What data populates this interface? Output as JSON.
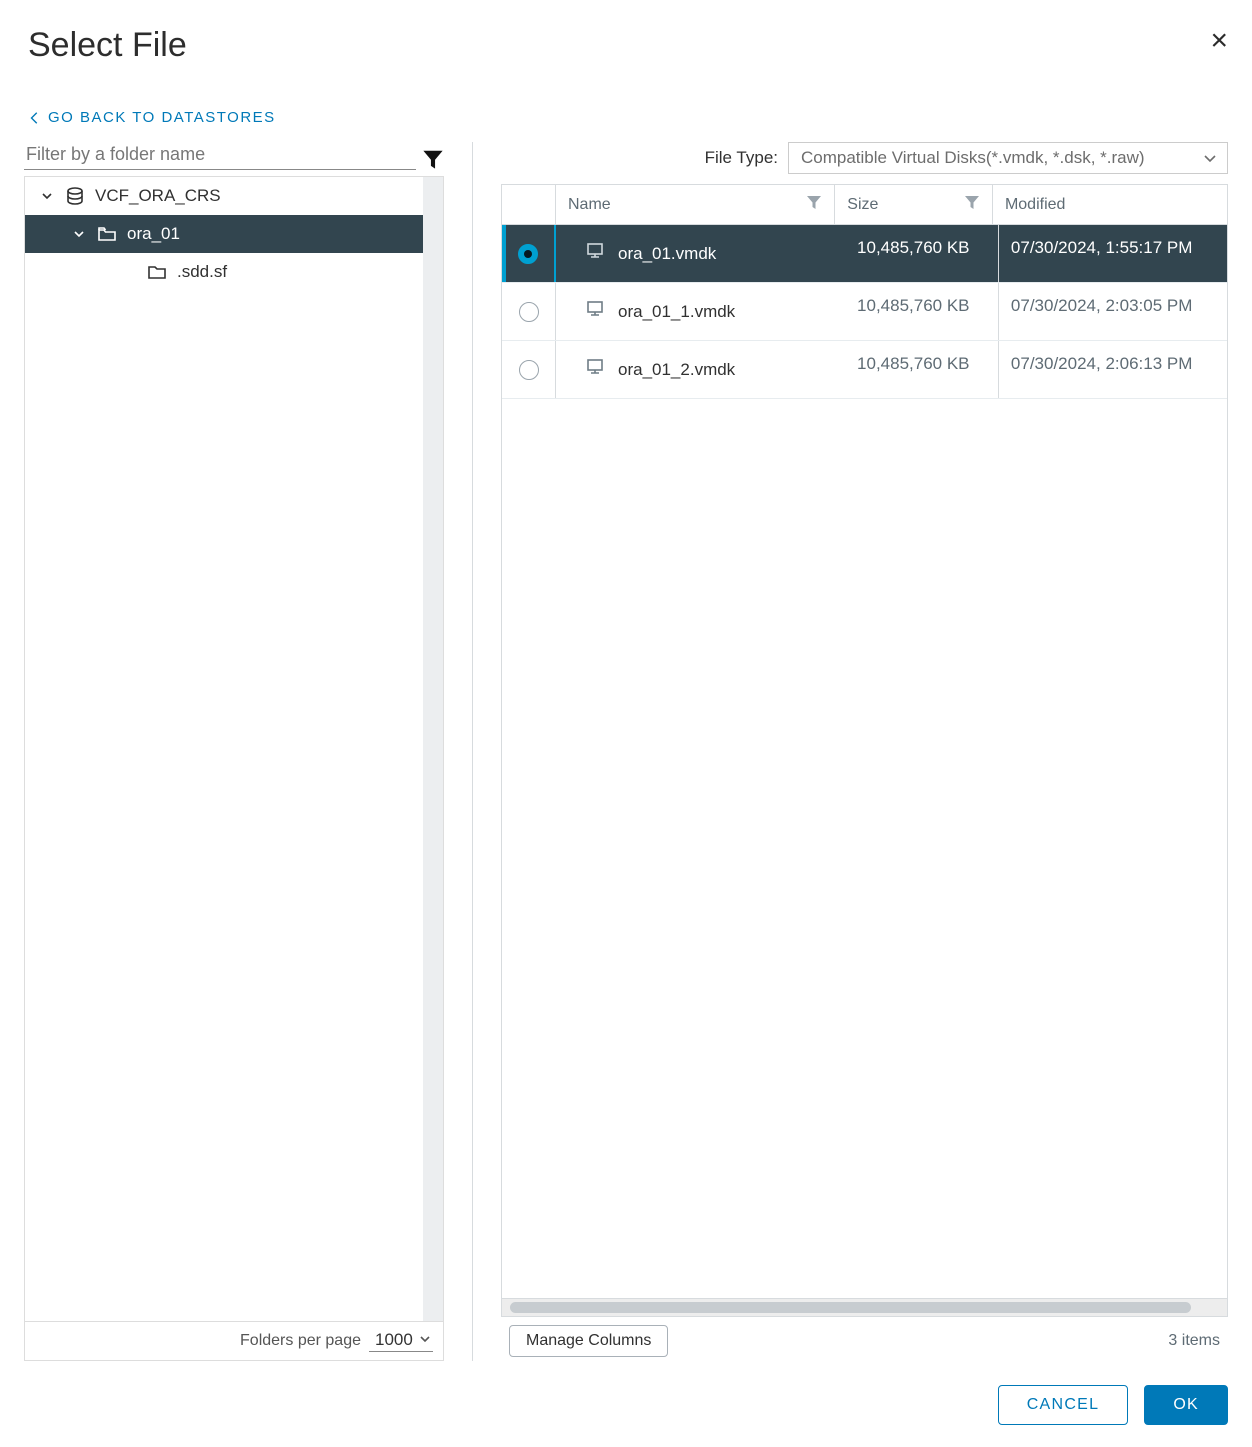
{
  "dialog": {
    "title": "Select File",
    "back_link": "GO BACK TO DATASTORES",
    "cancel_label": "CANCEL",
    "ok_label": "OK"
  },
  "left": {
    "filter_placeholder": "Filter by a folder name",
    "folders_per_page_label": "Folders per page",
    "folders_per_page_value": "1000",
    "tree": {
      "root": {
        "label": "VCF_ORA_CRS"
      },
      "folder_open": {
        "label": "ora_01"
      },
      "folder_child": {
        "label": ".sdd.sf"
      }
    }
  },
  "right": {
    "file_type_label": "File Type:",
    "file_type_value": "Compatible Virtual Disks(*.vmdk, *.dsk, *.raw)",
    "columns": {
      "name": "Name",
      "size": "Size",
      "modified": "Modified"
    },
    "files": [
      {
        "name": "ora_01.vmdk",
        "size": "10,485,760 KB",
        "modified": "07/30/2024, 1:55:17 PM",
        "selected": true
      },
      {
        "name": "ora_01_1.vmdk",
        "size": "10,485,760 KB",
        "modified": "07/30/2024, 2:03:05 PM",
        "selected": false
      },
      {
        "name": "ora_01_2.vmdk",
        "size": "10,485,760 KB",
        "modified": "07/30/2024, 2:06:13 PM",
        "selected": false
      }
    ],
    "manage_columns_label": "Manage Columns",
    "items_count_label": "3 items"
  }
}
